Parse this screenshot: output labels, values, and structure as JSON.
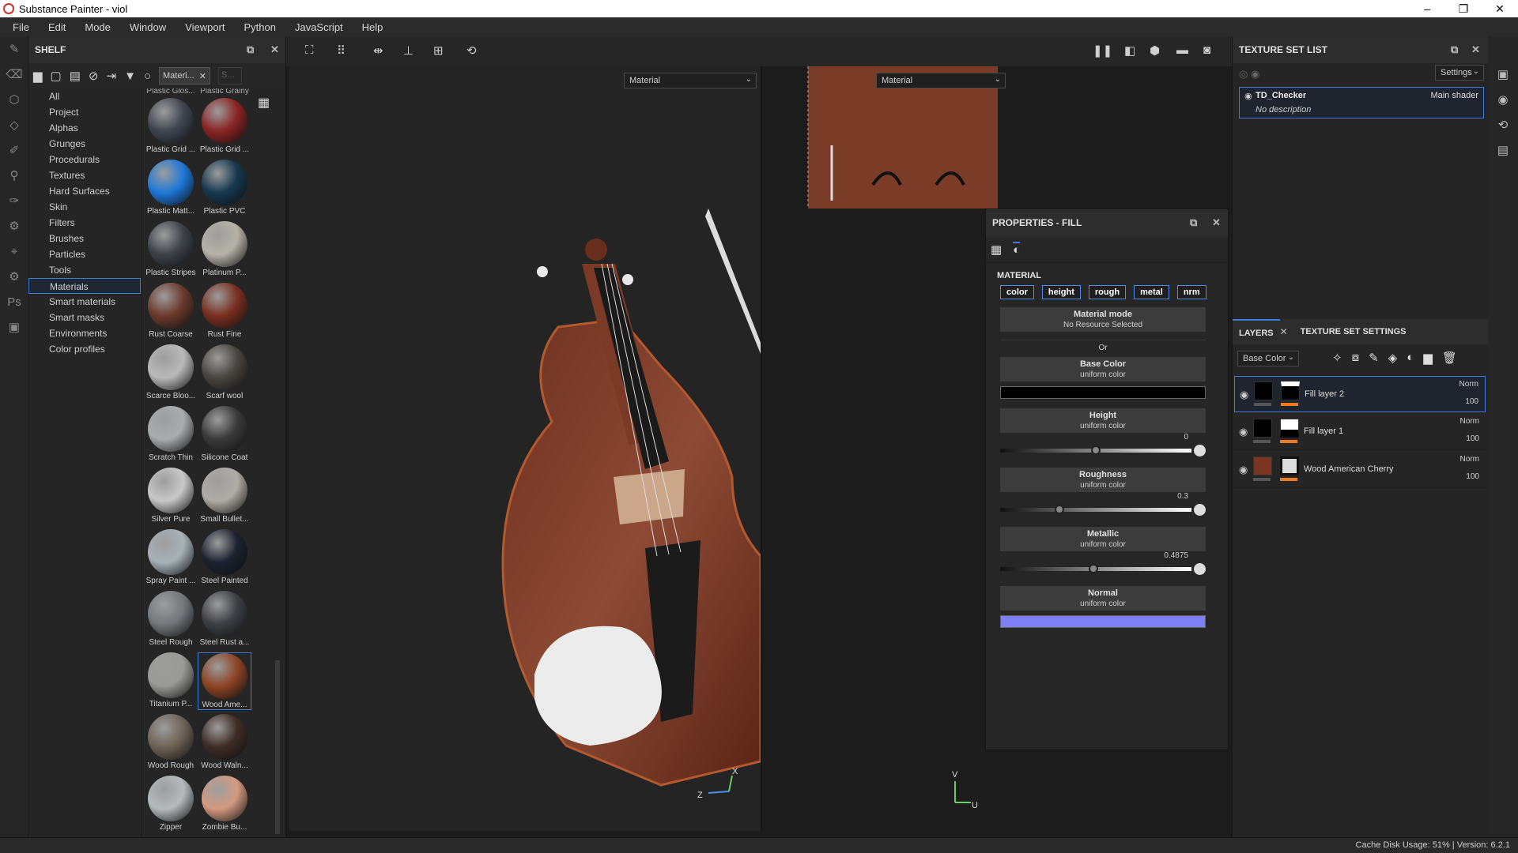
{
  "window": {
    "title": "Substance Painter - viol",
    "minimize": "–",
    "maximize": "❐",
    "close": "✕"
  },
  "menu": [
    "File",
    "Edit",
    "Mode",
    "Window",
    "Viewport",
    "Python",
    "JavaScript",
    "Help"
  ],
  "shelf": {
    "title": "SHELF",
    "filter_tag": "Materi...",
    "search_placeholder": "S...",
    "categories": [
      "All",
      "Project",
      "Alphas",
      "Grunges",
      "Procedurals",
      "Textures",
      "Hard Surfaces",
      "Skin",
      "Filters",
      "Brushes",
      "Particles",
      "Tools",
      "Materials",
      "Smart materials",
      "Smart masks",
      "Environments",
      "Color profiles"
    ],
    "active_category": "Materials",
    "top_labels": [
      "Plastic Glos...",
      "Plastic Grainy"
    ],
    "materials": [
      {
        "label": "Plastic Grid ...",
        "color": "#3f4650"
      },
      {
        "label": "Plastic Grid ...",
        "color": "#8a2424"
      },
      {
        "label": "Plastic Matt...",
        "color": "#1e78d8"
      },
      {
        "label": "Plastic PVC",
        "color": "#16384f"
      },
      {
        "label": "Plastic Stripes",
        "color": "#3d4249"
      },
      {
        "label": "Platinum P...",
        "color": "#b6b2a8"
      },
      {
        "label": "Rust Coarse",
        "color": "#6b3a2c"
      },
      {
        "label": "Rust Fine",
        "color": "#7a2f20"
      },
      {
        "label": "Scarce Bloo...",
        "color": "#b9b9b9"
      },
      {
        "label": "Scarf wool",
        "color": "#4a4540"
      },
      {
        "label": "Scratch Thin",
        "color": "#a9acaf"
      },
      {
        "label": "Silicone Coat",
        "color": "#3a3a3a"
      },
      {
        "label": "Silver Pure",
        "color": "#c8c8c8"
      },
      {
        "label": "Small Bullet...",
        "color": "#b0aca6"
      },
      {
        "label": "Spray Paint ...",
        "color": "#a7b2b8"
      },
      {
        "label": "Steel Painted",
        "color": "#1c2230"
      },
      {
        "label": "Steel Rough",
        "color": "#74787c"
      },
      {
        "label": "Steel Rust a...",
        "color": "#3c3f44"
      },
      {
        "label": "Titanium P...",
        "color": "#9a9a98"
      },
      {
        "label": "Wood Ame...",
        "color": "#8e4426"
      },
      {
        "label": "Wood Rough",
        "color": "#6e6357"
      },
      {
        "label": "Wood Waln...",
        "color": "#3e2c26"
      },
      {
        "label": "Zipper",
        "color": "#b5babd"
      },
      {
        "label": "Zombie Bu...",
        "color": "#d49a80"
      }
    ],
    "selected_material": "Wood Ame..."
  },
  "viewport": {
    "left_mode": "Material",
    "right_mode": "Material",
    "axis_3d": {
      "x": "X",
      "z": "Z"
    },
    "axis_uv": {
      "v": "V",
      "u": "U"
    }
  },
  "properties": {
    "title": "PROPERTIES - FILL",
    "section": "MATERIAL",
    "channels": [
      "color",
      "height",
      "rough",
      "metal",
      "nrm"
    ],
    "material_mode": {
      "title": "Material mode",
      "sub": "No Resource Selected"
    },
    "or_label": "Or",
    "base_color": {
      "title": "Base Color",
      "sub": "uniform color",
      "swatch": "#000000"
    },
    "height": {
      "title": "Height",
      "sub": "uniform color",
      "value": "0",
      "fraction": 0.5
    },
    "roughness": {
      "title": "Roughness",
      "sub": "uniform color",
      "value": "0.3",
      "fraction": 0.3
    },
    "metallic": {
      "title": "Metallic",
      "sub": "uniform color",
      "value": "0.4875",
      "fraction": 0.4875
    },
    "normal": {
      "title": "Normal",
      "sub": "uniform color",
      "swatch": "#7f7ff6"
    }
  },
  "texture_set_list": {
    "title": "TEXTURE SET LIST",
    "settings_label": "Settings",
    "item": {
      "name": "TD_Checker",
      "shader": "Main shader",
      "description": "No description"
    }
  },
  "layers": {
    "tab_layers": "LAYERS",
    "tab_texset": "TEXTURE SET SETTINGS",
    "channel": "Base Color",
    "items": [
      {
        "name": "Fill layer 2",
        "blend": "Norm",
        "opacity": "100"
      },
      {
        "name": "Fill layer 1",
        "blend": "Norm",
        "opacity": "100"
      },
      {
        "name": "Wood American Cherry",
        "blend": "Norm",
        "opacity": "100"
      }
    ]
  },
  "status": "Cache Disk Usage:    51% | Version: 6.2.1"
}
